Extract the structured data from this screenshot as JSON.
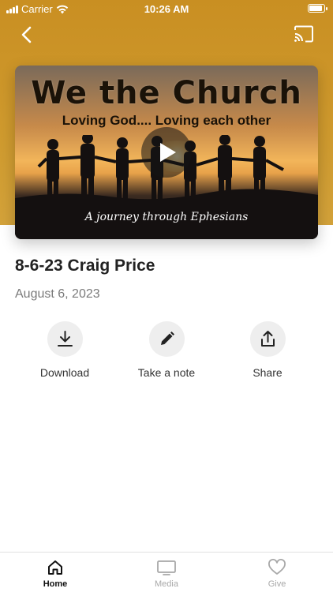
{
  "status_bar": {
    "carrier": "Carrier",
    "time": "10:26 AM",
    "battery_level": 0.95
  },
  "theme": {
    "header_color": "#cc9428",
    "icon_muted": "#a8a8a8",
    "action_bg": "#eeeeee"
  },
  "video": {
    "title": "We the Church",
    "tagline": "Loving God.... Loving each other",
    "caption": "A journey through Ephesians",
    "play_icon": "play-icon"
  },
  "sermon": {
    "title": "8-6-23 Craig Price",
    "date": "August 6, 2023"
  },
  "actions": [
    {
      "label": "Download",
      "icon": "download-icon"
    },
    {
      "label": "Take a note",
      "icon": "pencil-icon"
    },
    {
      "label": "Share",
      "icon": "share-icon"
    }
  ],
  "tabs": [
    {
      "label": "Home",
      "icon": "home-icon",
      "active": true
    },
    {
      "label": "Media",
      "icon": "tv-icon",
      "active": false
    },
    {
      "label": "Give",
      "icon": "heart-icon",
      "active": false
    }
  ]
}
